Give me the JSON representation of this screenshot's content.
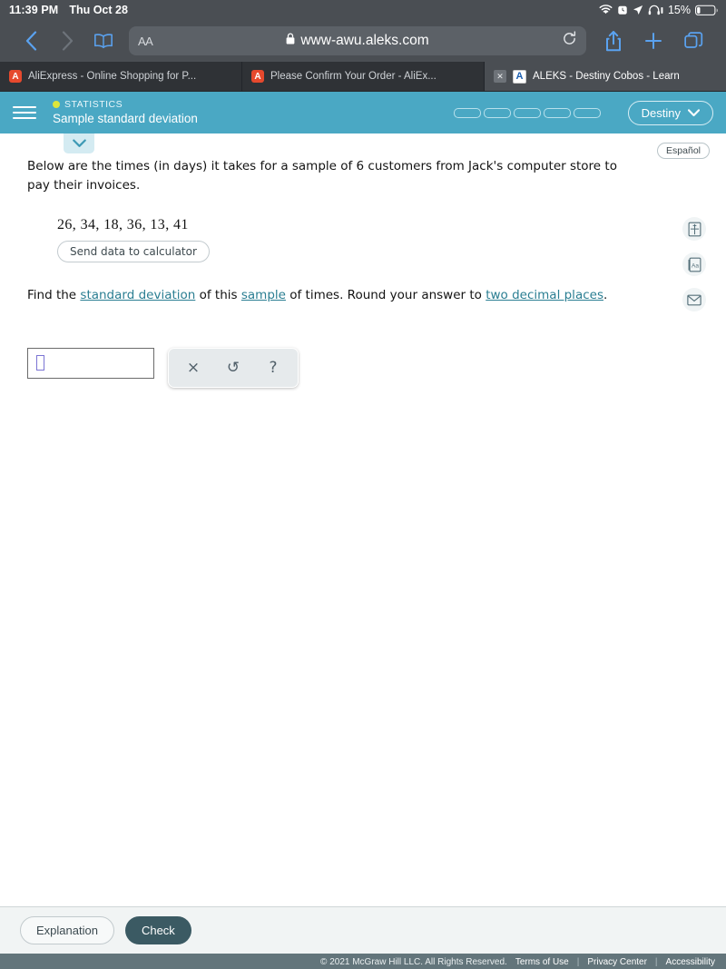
{
  "status_bar": {
    "time": "11:39 PM",
    "date": "Thu Oct 28",
    "battery_percent": "15%",
    "icons": [
      "wifi-icon",
      "alarm-icon",
      "location-arrow-icon",
      "headphones-icon",
      "battery-icon"
    ]
  },
  "browser": {
    "back_icon": "chevron-left-icon",
    "forward_icon": "chevron-right-icon",
    "bookmarks_icon": "book-icon",
    "text_size_label": "AA",
    "lock_icon": "lock-icon",
    "url": "www-awu.aleks.com",
    "reload_icon": "reload-icon",
    "share_icon": "share-icon",
    "new_tab_icon": "plus-icon",
    "tabs_icon": "tabs-icon",
    "tabs": [
      {
        "title": "AliExpress - Online Shopping for P...",
        "favicon": "aliexpress-icon",
        "active": false,
        "closable": false
      },
      {
        "title": "Please Confirm Your Order - AliEx...",
        "favicon": "aliexpress-icon",
        "active": false,
        "closable": false
      },
      {
        "title": "ALEKS - Destiny Cobos - Learn",
        "favicon": "aleks-icon",
        "active": true,
        "closable": true
      }
    ]
  },
  "aleks_header": {
    "menu_icon": "hamburger-menu-icon",
    "course": "STATISTICS",
    "topic": "Sample standard deviation",
    "progress_segments": 5,
    "progress_filled": 0,
    "user_name": "Destiny",
    "user_chevron_icon": "chevron-down-icon"
  },
  "content": {
    "collapse_icon": "chevron-down-icon",
    "espanol_label": "Español",
    "question_text_part1": "Below are the times (in days) it takes for a sample of 6 customers from Jack's computer store to pay their invoices.",
    "data_values": "26, 34, 18, 36, 13, 41",
    "send_to_calculator_label": "Send data to calculator",
    "prompt_prefix": "Find the ",
    "link_standard_deviation": "standard deviation",
    "prompt_mid1": " of this ",
    "link_sample": "sample",
    "prompt_mid2": " of times. Round your answer to ",
    "link_two_decimal_places": "two decimal places",
    "prompt_suffix": ".",
    "answer_value": "",
    "tool_clear_icon": "×",
    "tool_undo_icon": "↺",
    "tool_help_icon": "?",
    "rail_icons": [
      "reference-book-icon",
      "dictionary-aa-icon",
      "envelope-mail-icon"
    ]
  },
  "bottom_bar": {
    "explanation_label": "Explanation",
    "check_label": "Check"
  },
  "footer": {
    "copyright": "© 2021 McGraw Hill LLC. All Rights Reserved.",
    "links": [
      "Terms of Use",
      "Privacy Center",
      "Accessibility"
    ]
  },
  "colors": {
    "aleks_teal": "#4aa8c4",
    "browser_chrome": "#4a4e53",
    "tab_strip": "#2f3236",
    "link": "#2a7e92",
    "check_button": "#3b5a63",
    "footer_bar": "#63757b",
    "course_dot": "#dde63a"
  }
}
